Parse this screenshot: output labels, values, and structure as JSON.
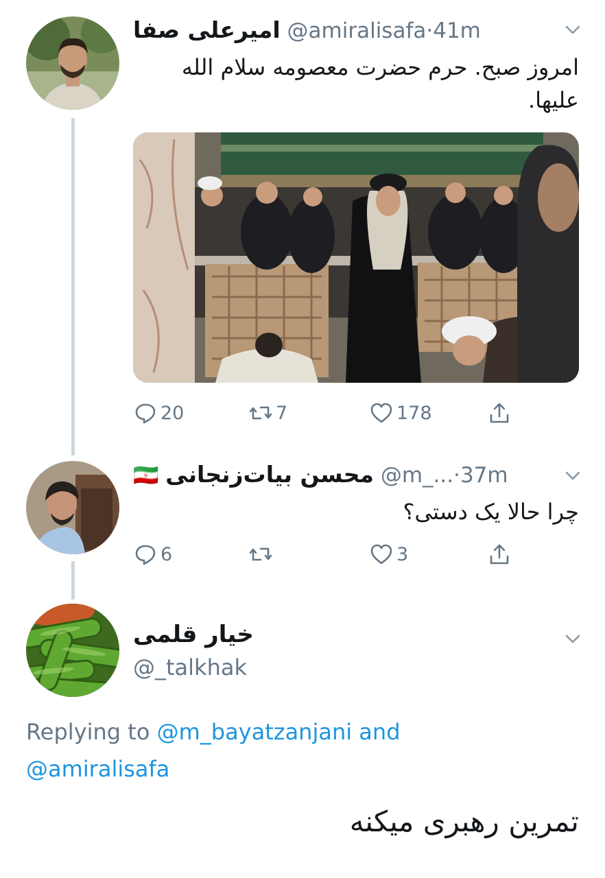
{
  "tweets": [
    {
      "display_name": "امیرعلی صفا",
      "handle": "@amiralisafa",
      "time": "41m",
      "text": "امروز صبح. حرم حضرت معصومه سلام الله علیها.",
      "actions": {
        "replies": "20",
        "retweets": "7",
        "likes": "178"
      }
    },
    {
      "display_name": "محسن بیات‌زنجانی",
      "flag": "🇮🇷",
      "handle": "@m_...",
      "time": "37m",
      "text": "چرا حالا یک دستی؟",
      "actions": {
        "replies": "6",
        "retweets": "",
        "likes": "3"
      }
    }
  ],
  "main_tweet": {
    "display_name": "خیار قلمی",
    "handle": "@_talkhak",
    "replying_label": "Replying to",
    "replying_mentions": [
      "@m_bayatzanjani",
      "@amiralisafa"
    ],
    "replying_and": "and",
    "text": "تمرین رهبری میکنه"
  },
  "separator": "·",
  "icons": [
    "reply-icon",
    "retweet-icon",
    "like-icon",
    "share-icon",
    "chevron-down-icon"
  ],
  "colors": {
    "secondary_text": "#657786",
    "link": "#1b95e0",
    "thread_line": "#ccd6dd"
  }
}
